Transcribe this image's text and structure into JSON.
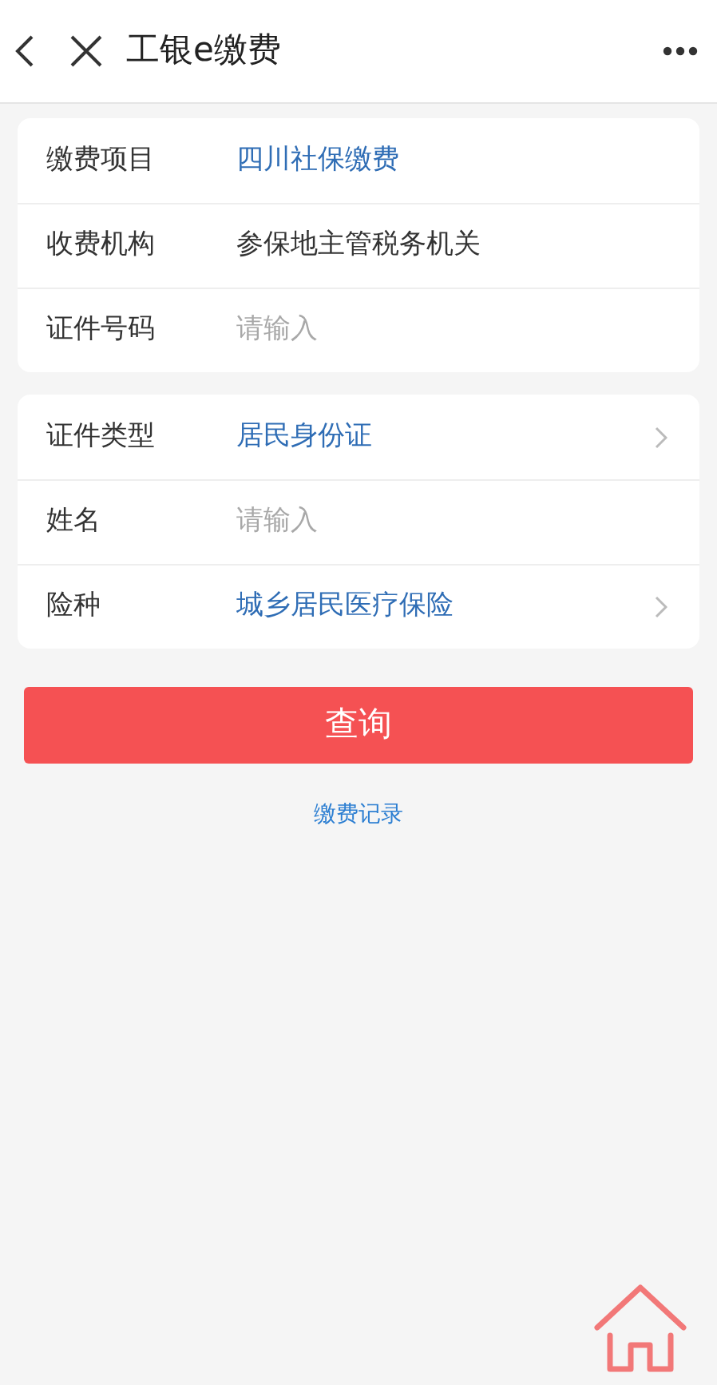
{
  "header": {
    "title": "工银e缴费"
  },
  "groups": [
    {
      "rows": [
        {
          "label": "缴费项目",
          "kind": "link",
          "value": "四川社保缴费"
        },
        {
          "label": "收费机构",
          "kind": "text",
          "value": "参保地主管税务机关"
        },
        {
          "label": "证件号码",
          "kind": "input",
          "placeholder": "请输入"
        }
      ]
    },
    {
      "rows": [
        {
          "label": "证件类型",
          "kind": "select",
          "value": "居民身份证"
        },
        {
          "label": "姓名",
          "kind": "input",
          "placeholder": "请输入"
        },
        {
          "label": "险种",
          "kind": "select",
          "value": "城乡居民医疗保险"
        }
      ]
    }
  ],
  "submit_button": "查询",
  "records_link": "缴费记录"
}
